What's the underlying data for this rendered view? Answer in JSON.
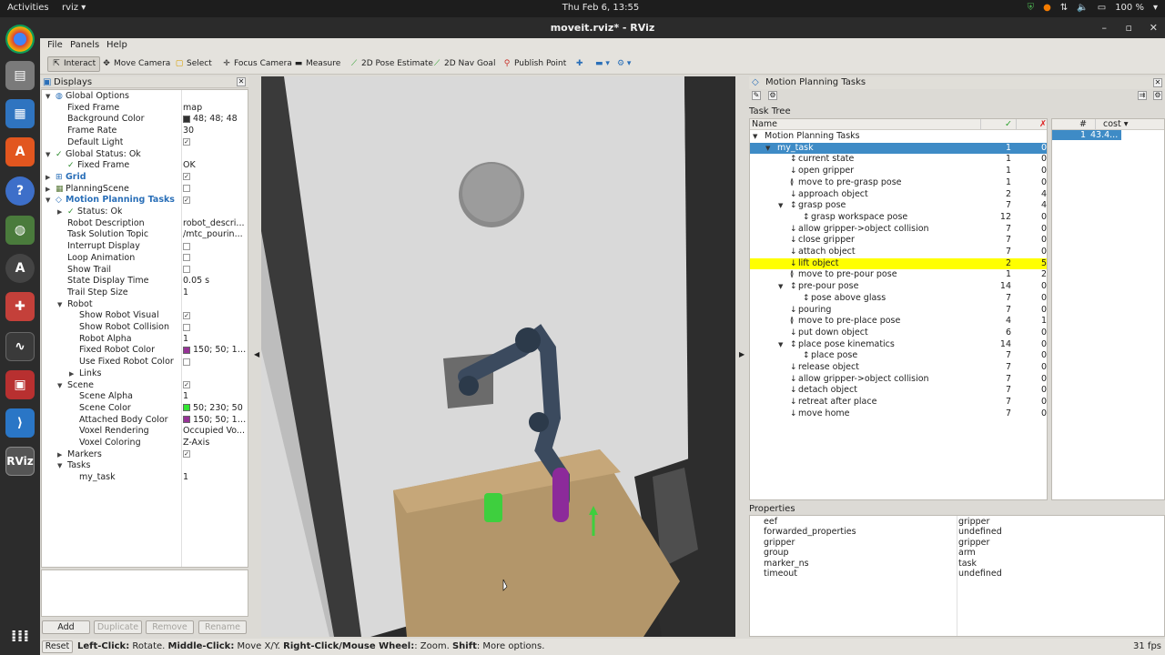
{
  "topbar": {
    "activities": "Activities",
    "app": "rviz ▾",
    "clock": "Thu Feb  6, 13:55",
    "battery": "100 %"
  },
  "window": {
    "title": "moveit.rviz* - RViz"
  },
  "menu": [
    "File",
    "Panels",
    "Help"
  ],
  "toolbar": [
    {
      "label": "Interact",
      "icon": "cursor-icon"
    },
    {
      "label": "Move Camera",
      "icon": "camera-move-icon"
    },
    {
      "label": "Select",
      "icon": "select-box-icon"
    },
    {
      "label": "Focus Camera",
      "icon": "focus-icon"
    },
    {
      "label": "Measure",
      "icon": "ruler-icon"
    },
    {
      "label": "2D Pose Estimate",
      "icon": "green-arrow-icon"
    },
    {
      "label": "2D Nav Goal",
      "icon": "green-arrow-icon"
    },
    {
      "label": "Publish Point",
      "icon": "pin-icon"
    }
  ],
  "displays": {
    "title": "Displays",
    "rows": [
      {
        "label": "Global Options",
        "value": "",
        "level": 0,
        "arrow": "▼",
        "icon": "globe-icon"
      },
      {
        "label": "Fixed Frame",
        "value": "map",
        "level": 1
      },
      {
        "label": "Background Color",
        "value": "48; 48; 48",
        "level": 1,
        "swatch": "#303030"
      },
      {
        "label": "Frame Rate",
        "value": "30",
        "level": 1
      },
      {
        "label": "Default Light",
        "value": "✓",
        "level": 1,
        "check": true
      },
      {
        "label": "Global Status: Ok",
        "value": "",
        "level": 0,
        "arrow": "▼",
        "icon": "ok-icon"
      },
      {
        "label": "Fixed Frame",
        "value": "OK",
        "level": 1,
        "icon": "ok-icon"
      },
      {
        "label": "Grid",
        "value": "✓",
        "level": 0,
        "arrow": "▶",
        "icon": "grid-icon",
        "check": true,
        "blue": true
      },
      {
        "label": "PlanningScene",
        "value": "",
        "level": 0,
        "arrow": "▶",
        "icon": "scene-icon",
        "check": true
      },
      {
        "label": "Motion Planning Tasks",
        "value": "✓",
        "level": 0,
        "arrow": "▼",
        "icon": "mpt-icon",
        "check": true,
        "blue": true
      },
      {
        "label": "Status: Ok",
        "value": "",
        "level": 1,
        "arrow": "▶",
        "icon": "ok-icon"
      },
      {
        "label": "Robot Description",
        "value": "robot_descri...",
        "level": 1
      },
      {
        "label": "Task Solution Topic",
        "value": "/mtc_pourin...",
        "level": 1
      },
      {
        "label": "Interrupt Display",
        "value": "",
        "level": 1,
        "check": true
      },
      {
        "label": "Loop Animation",
        "value": "",
        "level": 1,
        "check": true
      },
      {
        "label": "Show Trail",
        "value": "",
        "level": 1,
        "check": true
      },
      {
        "label": "State Display Time",
        "value": "0.05 s",
        "level": 1
      },
      {
        "label": "Trail Step Size",
        "value": "1",
        "level": 1
      },
      {
        "label": "Robot",
        "value": "",
        "level": 1,
        "arrow": "▼"
      },
      {
        "label": "Show Robot Visual",
        "value": "✓",
        "level": 2,
        "check": true
      },
      {
        "label": "Show Robot Collision",
        "value": "",
        "level": 2,
        "check": true
      },
      {
        "label": "Robot Alpha",
        "value": "1",
        "level": 2
      },
      {
        "label": "Fixed Robot Color",
        "value": "150; 50; 150",
        "level": 2,
        "swatch": "#963296"
      },
      {
        "label": "Use Fixed Robot Color",
        "value": "",
        "level": 2,
        "check": true
      },
      {
        "label": "Links",
        "value": "",
        "level": 2,
        "arrow": "▶"
      },
      {
        "label": "Scene",
        "value": "✓",
        "level": 1,
        "arrow": "▼",
        "check": true
      },
      {
        "label": "Scene Alpha",
        "value": "1",
        "level": 2
      },
      {
        "label": "Scene Color",
        "value": "50; 230; 50",
        "level": 2,
        "swatch": "#32e632"
      },
      {
        "label": "Attached Body Color",
        "value": "150; 50; 150",
        "level": 2,
        "swatch": "#963296"
      },
      {
        "label": "Voxel Rendering",
        "value": "Occupied Vo...",
        "level": 2
      },
      {
        "label": "Voxel Coloring",
        "value": "Z-Axis",
        "level": 2
      },
      {
        "label": "Markers",
        "value": "✓",
        "level": 1,
        "arrow": "▶",
        "check": true
      },
      {
        "label": "Tasks",
        "value": "",
        "level": 1,
        "arrow": "▼"
      },
      {
        "label": "my_task",
        "value": "1",
        "level": 2
      }
    ],
    "buttons": {
      "add": "Add",
      "duplicate": "Duplicate",
      "remove": "Remove",
      "rename": "Rename"
    }
  },
  "mpt": {
    "title": "Motion Planning Tasks",
    "task_tree_label": "Task Tree",
    "columns": {
      "name": "Name",
      "ok": "✓",
      "fail": "✗"
    },
    "rows": [
      {
        "name": "Motion Planning Tasks",
        "ok": "",
        "fail": "",
        "level": 0,
        "arrow": "▼"
      },
      {
        "name": "my_task",
        "ok": "1",
        "fail": "0",
        "level": 1,
        "arrow": "▼",
        "sel": true
      },
      {
        "name": "current state",
        "ok": "1",
        "fail": "0",
        "level": 2,
        "icon": "↕"
      },
      {
        "name": "open gripper",
        "ok": "1",
        "fail": "0",
        "level": 2,
        "icon": "↓"
      },
      {
        "name": "move to pre-grasp pose",
        "ok": "1",
        "fail": "0",
        "level": 2,
        "icon": "≬"
      },
      {
        "name": "approach object",
        "ok": "2",
        "fail": "4",
        "level": 2,
        "icon": "↓"
      },
      {
        "name": "grasp pose",
        "ok": "7",
        "fail": "4",
        "level": 2,
        "icon": "↕",
        "arrow": "▼"
      },
      {
        "name": "grasp workspace pose",
        "ok": "12",
        "fail": "0",
        "level": 3,
        "icon": "↕"
      },
      {
        "name": "allow gripper->object collision",
        "ok": "7",
        "fail": "0",
        "level": 2,
        "icon": "↓"
      },
      {
        "name": "close gripper",
        "ok": "7",
        "fail": "0",
        "level": 2,
        "icon": "↓"
      },
      {
        "name": "attach object",
        "ok": "7",
        "fail": "0",
        "level": 2,
        "icon": "↓"
      },
      {
        "name": "lift object",
        "ok": "2",
        "fail": "5",
        "level": 2,
        "icon": "↓",
        "hl": true
      },
      {
        "name": "move to pre-pour pose",
        "ok": "1",
        "fail": "2",
        "level": 2,
        "icon": "≬"
      },
      {
        "name": "pre-pour pose",
        "ok": "14",
        "fail": "0",
        "level": 2,
        "icon": "↕",
        "arrow": "▼"
      },
      {
        "name": "pose above glass",
        "ok": "7",
        "fail": "0",
        "level": 3,
        "icon": "↕"
      },
      {
        "name": "pouring",
        "ok": "7",
        "fail": "0",
        "level": 2,
        "icon": "↓"
      },
      {
        "name": "move to pre-place pose",
        "ok": "4",
        "fail": "1",
        "level": 2,
        "icon": "≬"
      },
      {
        "name": "put down object",
        "ok": "6",
        "fail": "0",
        "level": 2,
        "icon": "↓"
      },
      {
        "name": "place pose kinematics",
        "ok": "14",
        "fail": "0",
        "level": 2,
        "icon": "↕",
        "arrow": "▼"
      },
      {
        "name": "place pose",
        "ok": "7",
        "fail": "0",
        "level": 3,
        "icon": "↕"
      },
      {
        "name": "release object",
        "ok": "7",
        "fail": "0",
        "level": 2,
        "icon": "↓"
      },
      {
        "name": "allow gripper->object collision",
        "ok": "7",
        "fail": "0",
        "level": 2,
        "icon": "↓"
      },
      {
        "name": "detach object",
        "ok": "7",
        "fail": "0",
        "level": 2,
        "icon": "↓"
      },
      {
        "name": "retreat after place",
        "ok": "7",
        "fail": "0",
        "level": 2,
        "icon": "↓"
      },
      {
        "name": "move home",
        "ok": "7",
        "fail": "0",
        "level": 2,
        "icon": "↓"
      }
    ],
    "solutions": {
      "col_num": "#",
      "col_cost": "cost ▾",
      "rows": [
        {
          "num": "1",
          "cost": "43.4..."
        }
      ]
    },
    "properties_label": "Properties",
    "properties": [
      {
        "k": "eef",
        "v": "gripper"
      },
      {
        "k": "forwarded_properties",
        "v": "undefined"
      },
      {
        "k": "gripper",
        "v": "gripper"
      },
      {
        "k": "group",
        "v": "arm"
      },
      {
        "k": "marker_ns",
        "v": "task"
      },
      {
        "k": "timeout",
        "v": "undefined"
      }
    ]
  },
  "status": {
    "reset": "Reset",
    "lc": "Left-Click:",
    "lc_d": " Rotate. ",
    "mc": "Middle-Click:",
    "mc_d": " Move X/Y. ",
    "rc": "Right-Click/Mouse Wheel:",
    "rc_d": ": Zoom. ",
    "sh": "Shift",
    "sh_d": ": More options.",
    "fps": "31 fps"
  }
}
